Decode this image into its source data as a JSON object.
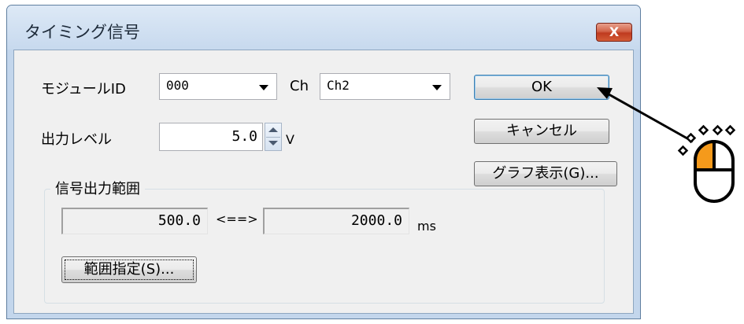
{
  "window": {
    "title": "タイミング信号",
    "close_label": "X"
  },
  "module": {
    "label": "モジュールID",
    "value": "000"
  },
  "channel": {
    "label": "Ch",
    "value": "Ch2"
  },
  "output_level": {
    "label": "出力レベル",
    "value": "5.0",
    "unit": "V"
  },
  "range_group": {
    "title": "信号出力範囲",
    "from": "500.0",
    "separator": "<==>",
    "to": "2000.0",
    "unit": "ms",
    "specify_button": "範囲指定(S)..."
  },
  "buttons": {
    "ok": "OK",
    "cancel": "キャンセル",
    "graph": "グラフ表示(G)..."
  },
  "icons": {
    "close": "close-icon",
    "mouse": "mouse-left-click-icon",
    "arrow": "pointer-arrow"
  },
  "colors": {
    "close_button": "#c8492c",
    "mouse_left_button": "#f59a1b",
    "title_bar": "#c7d9ee"
  }
}
